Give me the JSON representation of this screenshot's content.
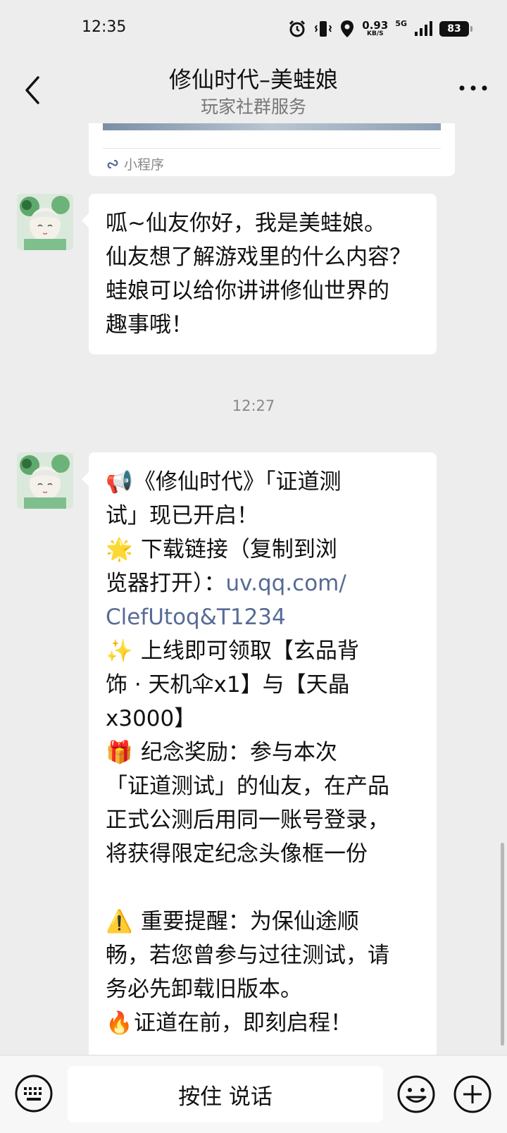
{
  "status_bar": {
    "time": "12:35",
    "net_speed": "0.93",
    "net_speed_unit": "KB/S",
    "network": "5G",
    "battery": "83"
  },
  "header": {
    "title": "修仙时代–美蛙娘",
    "subtitle": "玩家社群服务"
  },
  "mini_program": {
    "label": "小程序"
  },
  "messages": [
    {
      "lines": [
        "呱~仙友你好，我是美蛙娘。",
        "仙友想了解游戏里的什么内容？",
        "蛙娘可以给你讲讲修仙世界的",
        "趣事哦！"
      ]
    }
  ],
  "timestamp": "12:27",
  "announcement": {
    "line1": "《修仙时代》「证道测",
    "line2": "试」现已开启！",
    "line3": "下载链接（复制到浏",
    "line4a": "览器打开）：",
    "link_part1": "uv.qq.com/",
    "link_part2": "ClefUtoq&T1234",
    "line5": "上线即可领取【玄品背",
    "line6": "饰 · 天机伞x1】与【天晶",
    "line7": "x3000】",
    "line8": "纪念奖励：参与本次",
    "line9": "「证道测试」的仙友，在产品",
    "line10": "正式公测后用同一账号登录，",
    "line11": "将获得限定纪念头像框一份",
    "line12": "重要提醒：为保仙途顺",
    "line13": "畅，若您曾参与过往测试，请",
    "line14": "务必先卸载旧版本。",
    "line15": "证道在前，即刻启程！",
    "emoji_megaphone": "📢",
    "emoji_star": "🌟",
    "emoji_sparkles": "✨",
    "emoji_gift": "🎁",
    "emoji_warning": "⚠️",
    "emoji_fire": "🔥"
  },
  "input_bar": {
    "hold_to_talk": "按住 说话"
  }
}
